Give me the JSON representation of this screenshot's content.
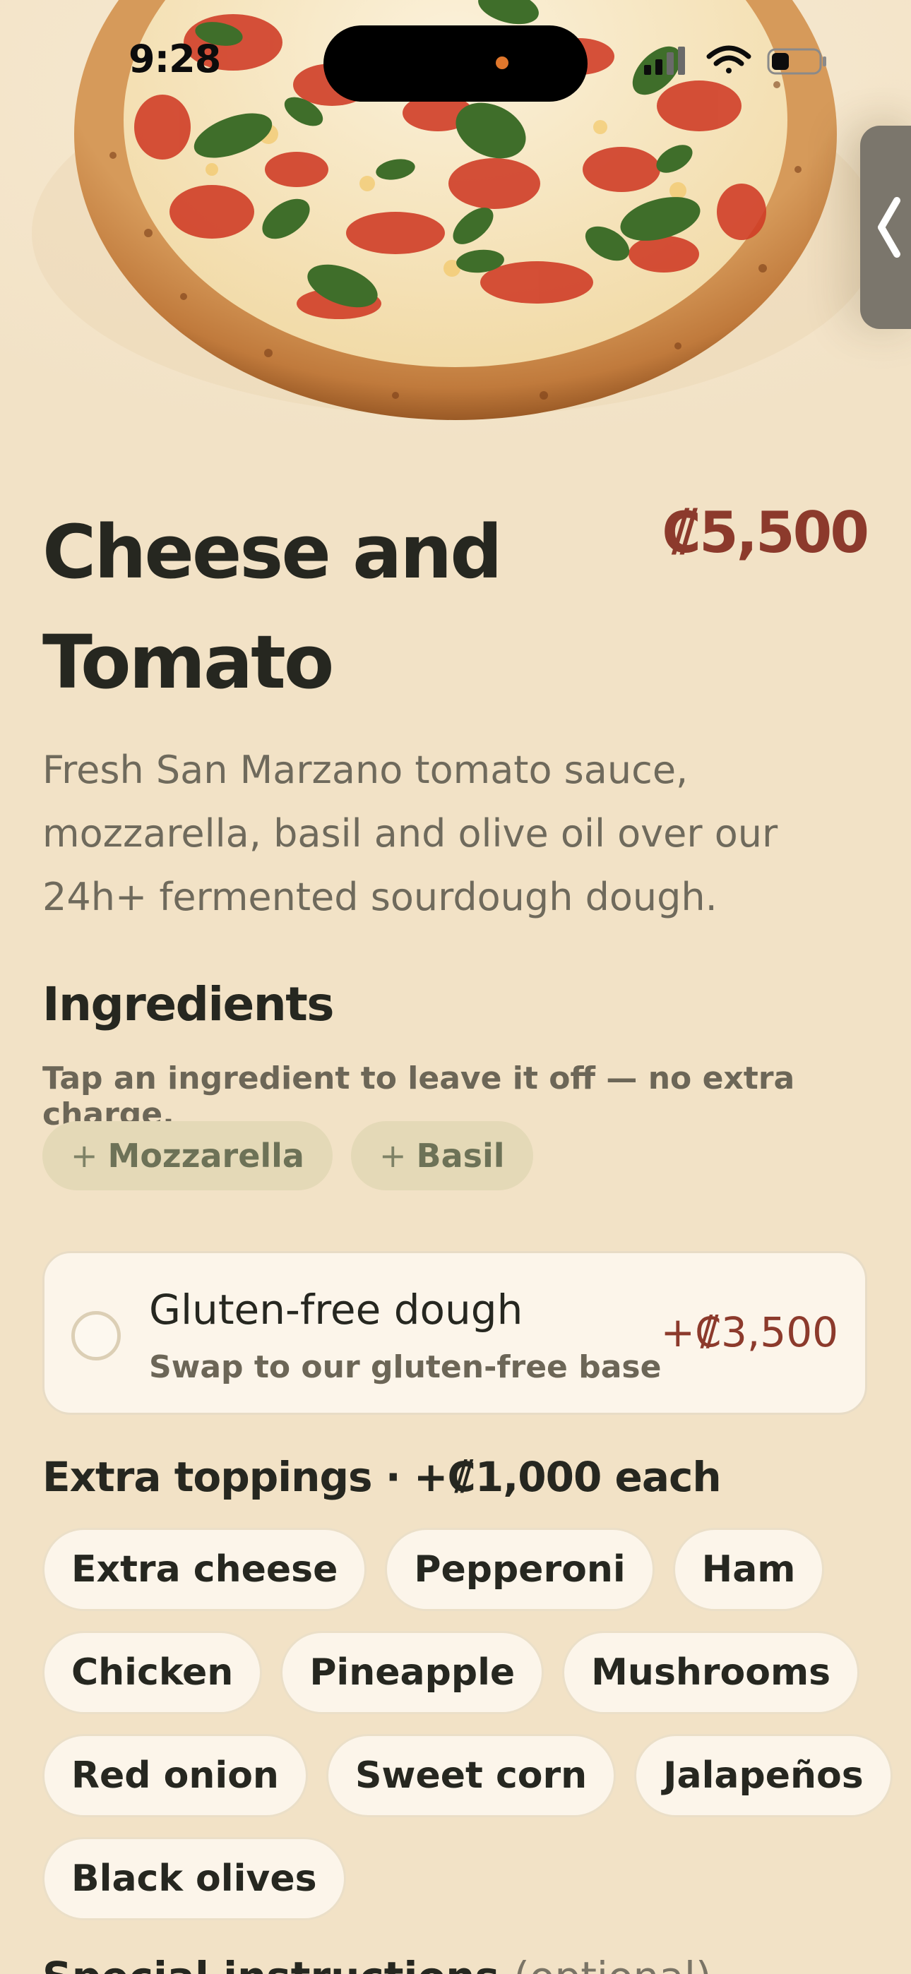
{
  "status_bar": {
    "time": "9:28"
  },
  "product": {
    "title": "Cheese and Tomato",
    "price": "₡5,500",
    "description": "Fresh San Marzano tomato sauce, mozzarella, basil and olive oil over our 24h+ fermented sourdough dough."
  },
  "ingredients": {
    "heading": "Ingredients",
    "hint": "Tap an ingredient to leave it off — no extra charge.",
    "items": [
      {
        "symbol": "+",
        "label": "Mozzarella"
      },
      {
        "symbol": "+",
        "label": "Basil"
      }
    ]
  },
  "gluten_free": {
    "title": "Gluten-free dough",
    "subtitle": "Swap to our gluten-free base",
    "price": "+₡3,500",
    "selected": false
  },
  "extra_toppings": {
    "heading": "Extra toppings · +₡1,000 each",
    "rows": [
      [
        "Extra cheese",
        "Pepperoni",
        "Ham"
      ],
      [
        "Chicken",
        "Pineapple",
        "Mushrooms"
      ],
      [
        "Red onion",
        "Sweet corn",
        "Jalapeños"
      ],
      [
        "Black olives"
      ]
    ]
  },
  "special_instructions": {
    "label": "Special instructions",
    "optional": "(optional)"
  },
  "icons": {
    "handle": "chevron-left-icon",
    "signal": "cellular-signal-icon",
    "wifi": "wifi-icon",
    "battery": "battery-icon"
  },
  "colors": {
    "background": "#f2e2c6",
    "accent_price": "#8c3a2c",
    "card": "#fcf5ea",
    "ingredient_chip": "#e4d9b7"
  }
}
